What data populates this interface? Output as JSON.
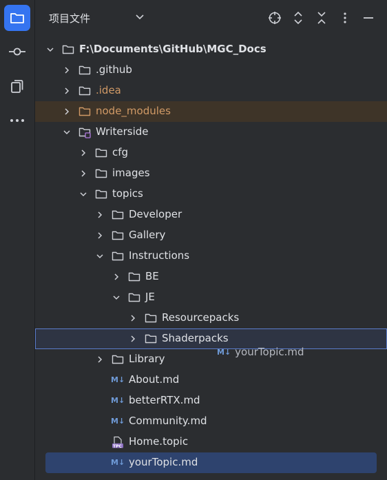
{
  "panel": {
    "title": "项目文件"
  },
  "icons": {
    "project": "folder-icon",
    "commit": "commit-icon",
    "structure": "structure-icon",
    "more": "more-icon",
    "locate": "locate-icon",
    "expand": "expand-all-icon",
    "collapse": "collapse-all-icon",
    "options": "options-icon",
    "hide": "minimize-icon"
  },
  "colors": {
    "accent": "#3574f0",
    "md": "#6f9ad6",
    "excluded": "#d19a66"
  },
  "tree": {
    "root": "F:\\Documents\\GitHub\\MGC_Docs",
    "github": ".github",
    "idea": ".idea",
    "node_modules": "node_modules",
    "writerside": "Writerside",
    "cfg": "cfg",
    "images": "images",
    "topics": "topics",
    "developer": "Developer",
    "gallery": "Gallery",
    "instructions": "Instructions",
    "be": "BE",
    "je": "JE",
    "resourcepacks": "Resourcepacks",
    "shaderpacks": "Shaderpacks",
    "library": "Library",
    "about": "About.md",
    "betterrtx": "betterRTX.md",
    "community": "Community.md",
    "home": "Home.topic",
    "yourtopic": "yourTopic.md",
    "md_badge": "M↓",
    "topic_badge": "TPC"
  },
  "drag": {
    "label": "yourTopic.md"
  }
}
